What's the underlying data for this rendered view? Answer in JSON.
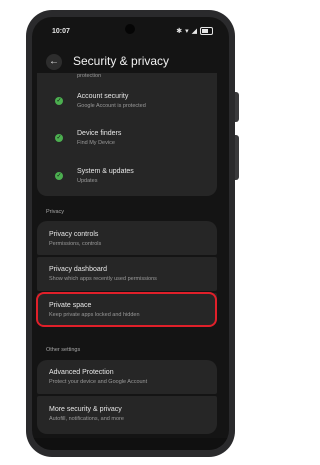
{
  "status": {
    "time": "10:07"
  },
  "header": {
    "title": "Security & privacy",
    "back_glyph": "←"
  },
  "top_partial_sub": "protection",
  "security_items": [
    {
      "title": "Account security",
      "sub": "Google Account is protected"
    },
    {
      "title": "Device finders",
      "sub": "Find My Device"
    },
    {
      "title": "System & updates",
      "sub": "Updates"
    }
  ],
  "privacy": {
    "section": "Privacy",
    "items": [
      {
        "title": "Privacy controls",
        "sub": "Permissions, controls"
      },
      {
        "title": "Privacy dashboard",
        "sub": "Show which apps recently used permissions"
      },
      {
        "title": "Private space",
        "sub": "Keep private apps locked and hidden"
      }
    ]
  },
  "other": {
    "section": "Other settings",
    "items": [
      {
        "title": "Advanced Protection",
        "sub": "Protect your device and Google Account"
      },
      {
        "title": "More security & privacy",
        "sub": "Autofill, notifications, and more"
      }
    ]
  },
  "colors": {
    "check": "#4caf50",
    "highlight": "#e0202a",
    "card": "#262626"
  }
}
